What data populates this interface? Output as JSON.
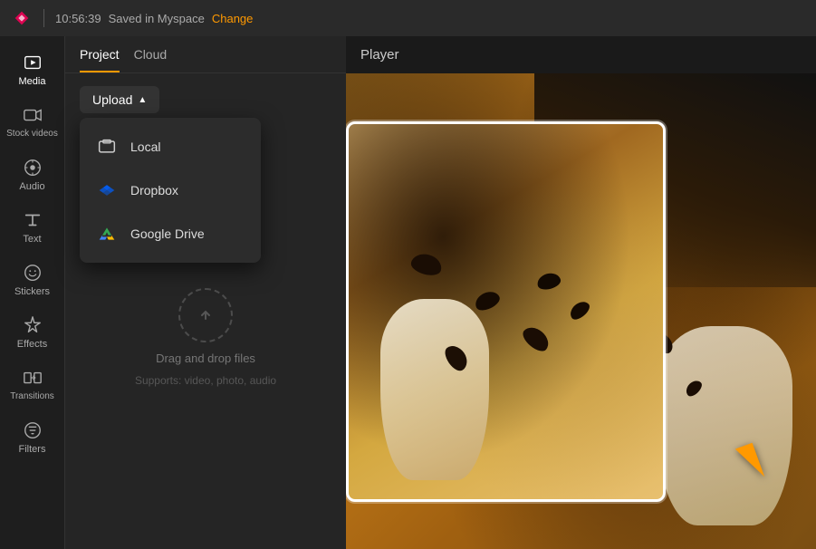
{
  "topbar": {
    "timestamp": "10:56:39",
    "save_status": "Saved in Myspace",
    "change_label": "Change"
  },
  "sidebar": {
    "items": [
      {
        "id": "media",
        "label": "Media",
        "active": true
      },
      {
        "id": "stock-videos",
        "label": "Stock videos",
        "active": false
      },
      {
        "id": "audio",
        "label": "Audio",
        "active": false
      },
      {
        "id": "text",
        "label": "Text",
        "active": false
      },
      {
        "id": "stickers",
        "label": "Stickers",
        "active": false
      },
      {
        "id": "effects",
        "label": "Effects",
        "active": false
      },
      {
        "id": "transitions",
        "label": "Transitions",
        "active": false
      },
      {
        "id": "filters",
        "label": "Filters",
        "active": false
      }
    ]
  },
  "panel": {
    "tabs": [
      {
        "id": "project",
        "label": "Project",
        "active": true
      },
      {
        "id": "cloud",
        "label": "Cloud",
        "active": false
      }
    ],
    "upload_button": "Upload",
    "dropdown": {
      "items": [
        {
          "id": "local",
          "label": "Local"
        },
        {
          "id": "dropbox",
          "label": "Dropbox"
        },
        {
          "id": "google-drive",
          "label": "Google Drive"
        }
      ]
    },
    "drag_drop_text": "Drag and drop files",
    "drag_drop_subtext": "Supports: video, photo, audio"
  },
  "player": {
    "title": "Player"
  }
}
